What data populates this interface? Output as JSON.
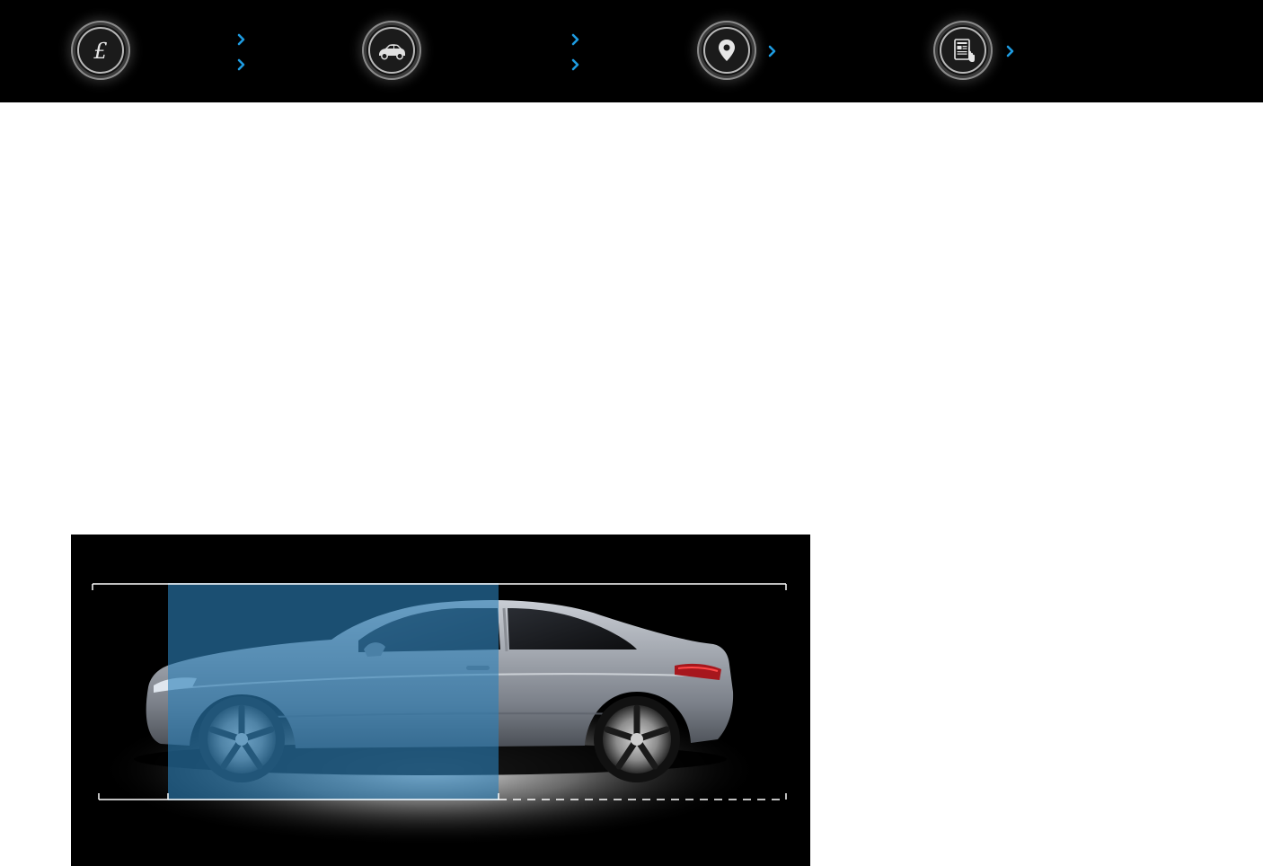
{
  "nav": {
    "items": [
      {
        "icon": "pound-sign-icon",
        "links": [
          "",
          ""
        ]
      },
      {
        "icon": "car-icon",
        "links": [
          "",
          ""
        ]
      },
      {
        "icon": "location-pin-icon",
        "links": [
          ""
        ]
      },
      {
        "icon": "news-tablet-icon",
        "links": [
          ""
        ]
      }
    ]
  },
  "colors": {
    "topbar_bg": "#000000",
    "chevron_accent": "#1e9be0",
    "highlight_overlay": "#2b7fb8"
  },
  "hero": {
    "image": "car-side-profile-dimensions"
  }
}
